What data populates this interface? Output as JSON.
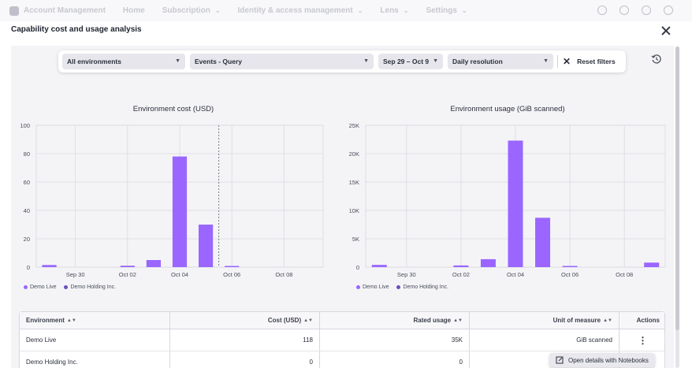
{
  "topnav": {
    "app": "Account Management",
    "items": [
      "Home",
      "Subscription",
      "Identity & access management",
      "Lens",
      "Settings"
    ]
  },
  "modal": {
    "title": "Capability cost and usage analysis"
  },
  "filters": {
    "environment": "All environments",
    "capability": "Events - Query",
    "daterange": "Sep 29 – Oct 9",
    "resolution": "Daily resolution",
    "reset": "Reset filters"
  },
  "colors": {
    "primary_bar": "#9a66ff",
    "secondary_bar": "#6b4fbb",
    "grid": "#d9d9e0"
  },
  "legend": {
    "series1": "Demo Live",
    "series2": "Demo Holding Inc."
  },
  "chart_data": [
    {
      "type": "bar",
      "title": "Environment cost (USD)",
      "x": [
        "Sep 29",
        "Sep 30",
        "Oct 01",
        "Oct 02",
        "Oct 03",
        "Oct 04",
        "Oct 05",
        "Oct 06",
        "Oct 07",
        "Oct 08",
        "Oct 09"
      ],
      "x_tick_labels": [
        "Sep 30",
        "Oct 02",
        "Oct 04",
        "Oct 06",
        "Oct 08"
      ],
      "series": [
        {
          "name": "Demo Live",
          "values": [
            1.5,
            0,
            0,
            1,
            5,
            78,
            30,
            0.8,
            0,
            0,
            0
          ]
        },
        {
          "name": "Demo Holding Inc.",
          "values": [
            0,
            0,
            0,
            0,
            0,
            0,
            0,
            0,
            0,
            0,
            0
          ]
        }
      ],
      "ylim": [
        0,
        100
      ],
      "y_ticks": [
        "0",
        "20",
        "40",
        "60",
        "80",
        "100"
      ],
      "vertical_marker_at": "Oct 06",
      "grid": true,
      "legend_position": "bottom-left"
    },
    {
      "type": "bar",
      "title": "Environment usage (GiB scanned)",
      "x": [
        "Sep 29",
        "Sep 30",
        "Oct 01",
        "Oct 02",
        "Oct 03",
        "Oct 04",
        "Oct 05",
        "Oct 06",
        "Oct 07",
        "Oct 08",
        "Oct 09"
      ],
      "x_tick_labels": [
        "Sep 30",
        "Oct 02",
        "Oct 04",
        "Oct 06",
        "Oct 08"
      ],
      "series": [
        {
          "name": "Demo Live",
          "values": [
            400,
            0,
            0,
            300,
            1400,
            22300,
            8700,
            200,
            0,
            0,
            800
          ]
        },
        {
          "name": "Demo Holding Inc.",
          "values": [
            0,
            0,
            0,
            0,
            0,
            0,
            0,
            0,
            0,
            0,
            0
          ]
        }
      ],
      "ylim": [
        0,
        25000
      ],
      "y_ticks": [
        "0",
        "5K",
        "10K",
        "15K",
        "20K",
        "25K"
      ],
      "grid": true,
      "legend_position": "bottom-left"
    }
  ],
  "table": {
    "headers": {
      "environment": "Environment",
      "cost": "Cost (USD)",
      "rated": "Rated usage",
      "unit": "Unit of measure",
      "actions": "Actions"
    },
    "rows": [
      {
        "environment": "Demo Live",
        "cost": "118",
        "rated": "35K",
        "unit": "GiB scanned"
      },
      {
        "environment": "Demo Holding Inc.",
        "cost": "0",
        "rated": "0",
        "unit": ""
      }
    ]
  },
  "notebook_button": "Open details with Notebooks"
}
